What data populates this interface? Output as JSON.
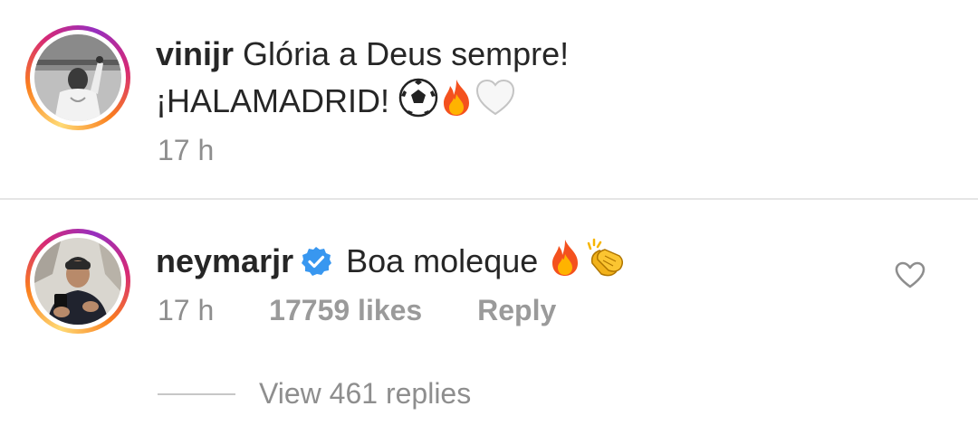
{
  "caption": {
    "username": "vinijr",
    "text_line1": "Glória a Deus sempre!",
    "text_line2": "¡HALAMADRID!",
    "emojis": [
      "soccer-ball",
      "fire",
      "white-heart"
    ],
    "time": "17 h"
  },
  "comment": {
    "username": "neymarjr",
    "verified": true,
    "text": "Boa moleque",
    "emojis": [
      "fire",
      "clapping-hands"
    ],
    "time": "17 h",
    "likes": "17759 likes",
    "reply_label": "Reply",
    "view_replies": "View 461 replies"
  },
  "colors": {
    "text": "#262626",
    "secondary": "#8e8e8e",
    "verified_blue": "#3897f0",
    "divider": "#e5e5e5"
  }
}
